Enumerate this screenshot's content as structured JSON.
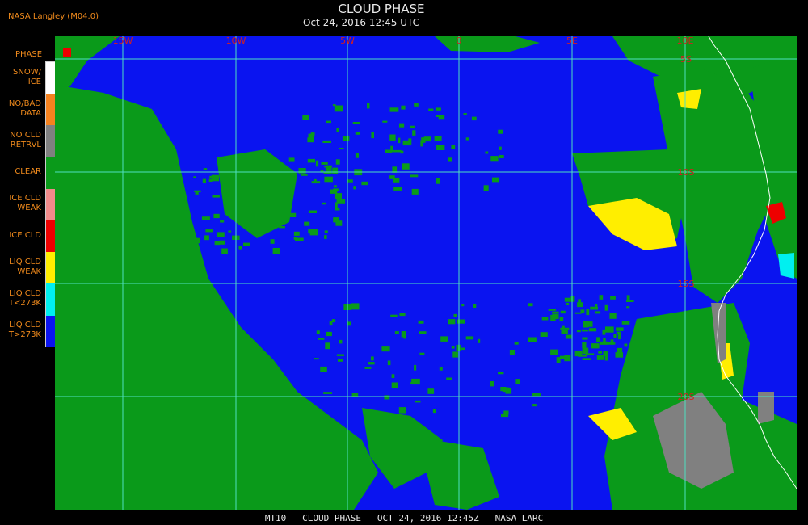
{
  "header": {
    "org": "NASA Langley (M04.0)",
    "title": "CLOUD PHASE",
    "subtitle": "Oct 24, 2016 12:45 UTC"
  },
  "footer": {
    "text": "MT10   CLOUD PHASE   OCT 24, 2016 12:45Z   NASA LARC"
  },
  "map": {
    "lon_labels": [
      "15W",
      "10W",
      "5W",
      "0",
      "5E",
      "10E"
    ],
    "lat_labels": [
      "5S",
      "10S",
      "15S",
      "20S"
    ],
    "grid_color": "#4ee0c0",
    "label_color": "#d22020",
    "coast_color": "#ffffff"
  },
  "legend": {
    "title": "PHASE",
    "items": [
      {
        "label": "SNOW/\nICE",
        "color": "#ffffff"
      },
      {
        "label": "NO/BAD\nDATA",
        "color": "#f5821f"
      },
      {
        "label": "NO CLD\nRETRVL",
        "color": "#808080"
      },
      {
        "label": "CLEAR",
        "color": "#0a9a1a"
      },
      {
        "label": "ICE CLD\nWEAK",
        "color": "#f08a8a"
      },
      {
        "label": "ICE CLD",
        "color": "#ee0000"
      },
      {
        "label": "LIQ CLD\nWEAK",
        "color": "#ffee00"
      },
      {
        "label": "LIQ CLD\nT<273K",
        "color": "#00f0f0"
      },
      {
        "label": "LIQ CLD\nT>273K",
        "color": "#0a14f0"
      }
    ]
  }
}
